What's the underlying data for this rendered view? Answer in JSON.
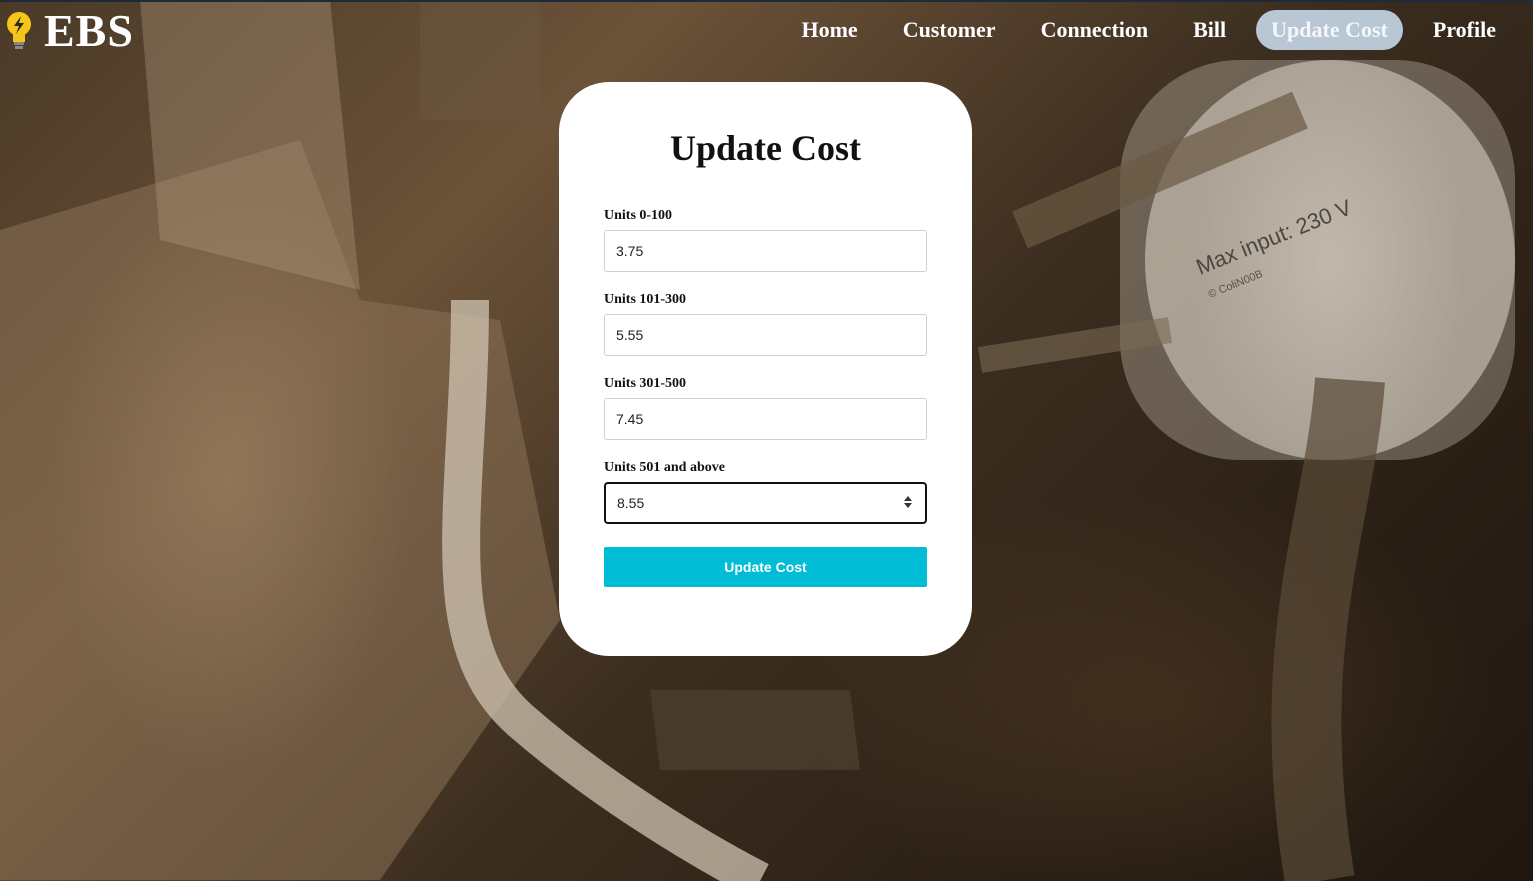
{
  "brand": {
    "logo_text": "EBS",
    "logo_icon": "lightbulb-bolt-icon"
  },
  "nav": {
    "items": [
      {
        "label": "Home",
        "active": false
      },
      {
        "label": "Customer",
        "active": false
      },
      {
        "label": "Connection",
        "active": false
      },
      {
        "label": "Bill",
        "active": false
      },
      {
        "label": "Update Cost",
        "active": true
      },
      {
        "label": "Profile",
        "active": false
      }
    ],
    "active_color": "#b8c7d3"
  },
  "form": {
    "title": "Update Cost",
    "fields": [
      {
        "label": "Units 0-100",
        "value": "3.75"
      },
      {
        "label": "Units 101-300",
        "value": "5.55"
      },
      {
        "label": "Units 301-500",
        "value": "7.45"
      },
      {
        "label": "Units 501 and above",
        "value": "8.55",
        "focused": true
      }
    ],
    "submit_label": "Update Cost",
    "submit_color": "#00bcd4"
  },
  "background": {
    "photo_text": "Max input: 230 V",
    "photo_credit": "© ColiN00B"
  }
}
